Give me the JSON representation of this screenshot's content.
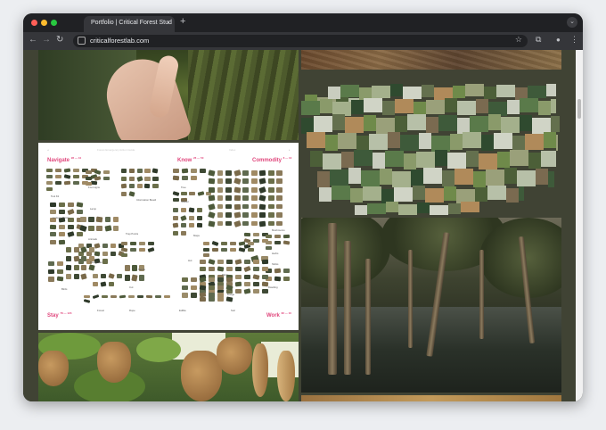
{
  "browser": {
    "tab_title": "Portfolio | Critical Forest Stud",
    "tab_close": "×",
    "new_tab": "+",
    "tab_menu": "⌄",
    "url": "criticalforestlab.com",
    "back": "←",
    "forward": "→",
    "reload": "↻",
    "star": "☆",
    "extensions": "⧉",
    "profile": "●",
    "menu": "⋮"
  },
  "document": {
    "header_left": "Forest Emergency Action Guide",
    "header_right": "Index",
    "sections": [
      {
        "name": "Navigate",
        "pages": "28 — 44"
      },
      {
        "name": "Know",
        "pages": "26 — 50"
      },
      {
        "name": "Commodity",
        "pages": "8 — 10"
      },
      {
        "name": "Stay",
        "pages": "78 — 123"
      },
      {
        "name": "Work",
        "pages": "82 — 10"
      }
    ],
    "labels": [
      "Tool Kit",
      "Foot signs",
      "Lamp",
      "Lookout Points",
      "Information Board",
      "Animals",
      "Trap Points",
      "Tree",
      "Shelter",
      "Fire Starter",
      "Mushrooms",
      "Cut",
      "Birds",
      "Seeds",
      "Hut",
      "Plant",
      "Maps",
      "Herbs",
      "Sticks",
      "Dwelling",
      "Edible",
      "Soil",
      "Bridge",
      "Forest",
      "Rope"
    ]
  },
  "colors": {
    "accent_pink": "#e0467c",
    "page_bg": "#404334"
  }
}
